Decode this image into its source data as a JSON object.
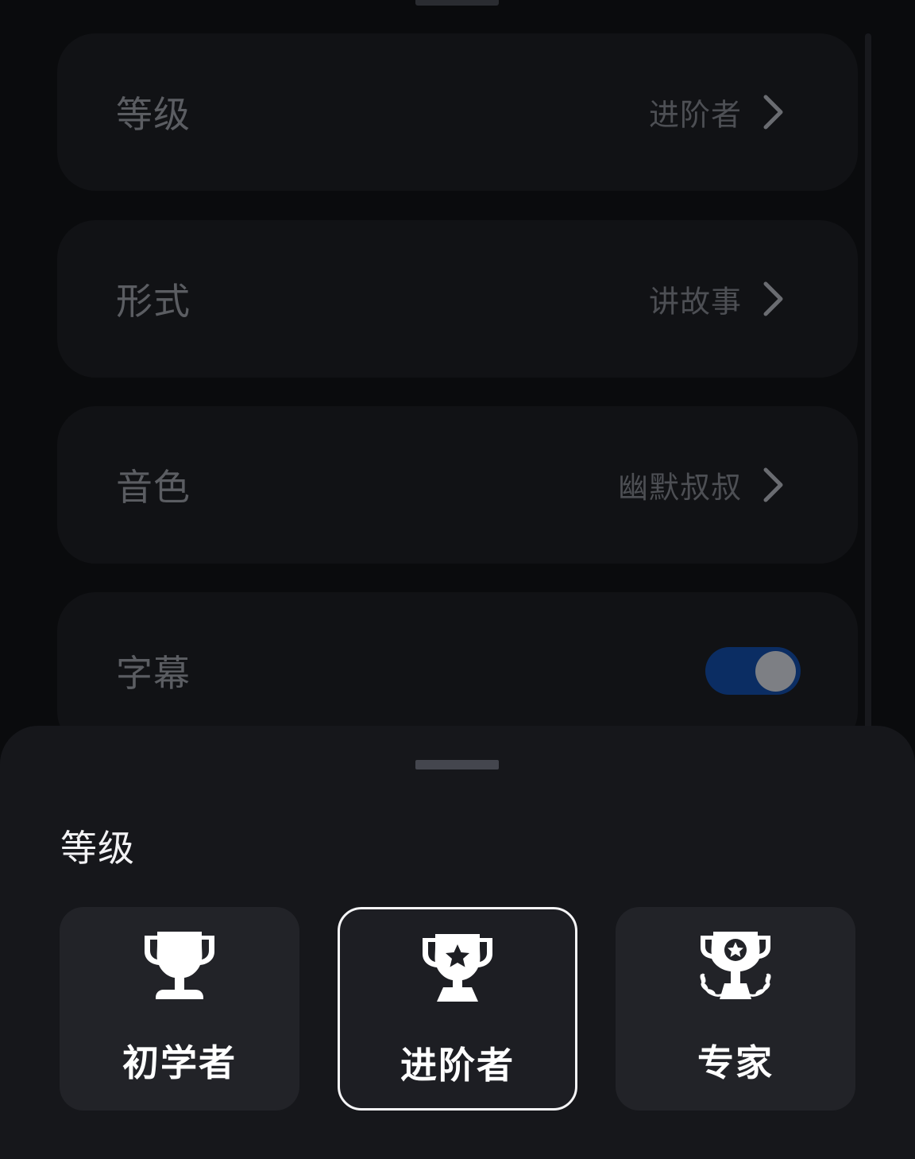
{
  "settings": {
    "items": [
      {
        "label": "等级",
        "value": "进阶者"
      },
      {
        "label": "形式",
        "value": "讲故事"
      },
      {
        "label": "音色",
        "value": "幽默叔叔"
      },
      {
        "label": "字幕",
        "toggle_on": true
      }
    ]
  },
  "sheet": {
    "title": "等级",
    "options": [
      {
        "label": "初学者",
        "icon": "trophy-icon",
        "selected": false
      },
      {
        "label": "进阶者",
        "icon": "star-trophy-icon",
        "selected": true
      },
      {
        "label": "专家",
        "icon": "laurel-trophy-icon",
        "selected": false
      }
    ]
  },
  "colors": {
    "background": "#0a0b0d",
    "card": "#111215",
    "sheet": "#16171b",
    "toggle_accent": "#0b2d63",
    "selected_border": "#f5f5f7"
  }
}
